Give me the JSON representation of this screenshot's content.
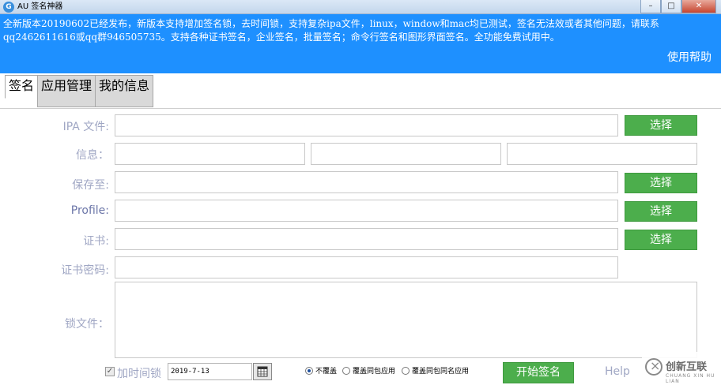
{
  "window": {
    "title": "AU 签名神器",
    "min": "–",
    "max": "□",
    "close": "✕"
  },
  "banner": {
    "notice": "全新版本20190602已经发布，新版本支持增加签名锁，去时间锁，支持复杂ipa文件，linux，window和mac均已测试，签名无法效或者其他问题，请联系qq2462611616或qq群946505735。支持各种证书签名，企业签名，批量签名；命令行签名和图形界面签名。全功能免费试用中。",
    "help": "使用帮助"
  },
  "tabs": [
    "签名",
    "应用管理",
    "我的信息"
  ],
  "form": {
    "ipa_label": "IPA 文件:",
    "info_label": "信息：",
    "save_label": "保存至:",
    "profile_label": "Profile:",
    "cert_label": "证书:",
    "password_label": "证书密码:",
    "lock_label": "锁文件：",
    "select_label": "选择"
  },
  "footer": {
    "time_lock_label": "加时间锁",
    "time_lock_checked": true,
    "date_value": "2019-7-13",
    "radio_options": [
      "不覆盖",
      "覆盖同包应用",
      "覆盖同包同名应用"
    ],
    "radio_selected": 0,
    "start_label": "开始签名",
    "help_label": "Help"
  },
  "watermark": {
    "text": "创新互联",
    "sub": "CHUANG XIN HU LIAN",
    "icon": "logo-icon"
  },
  "colors": {
    "banner": "#1e90ff",
    "button_green": "#4cae4c",
    "label": "#a0a7c4"
  }
}
